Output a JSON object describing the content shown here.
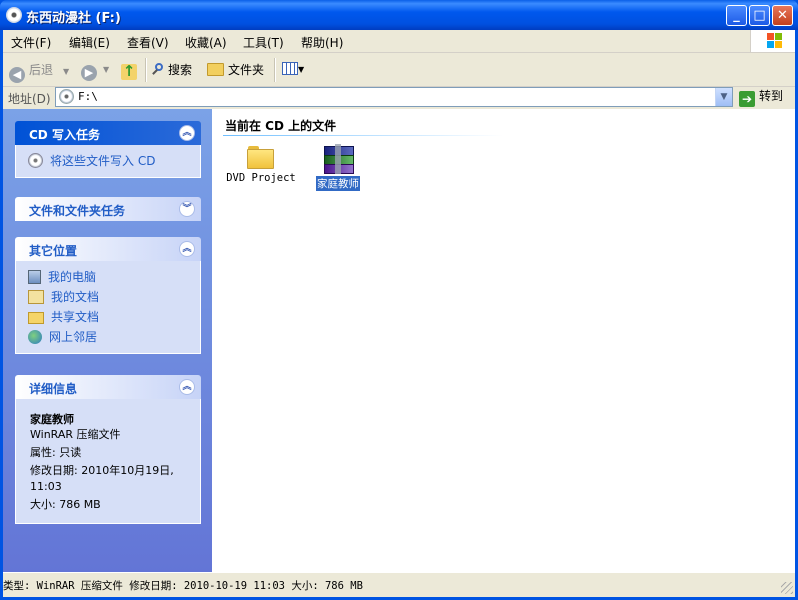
{
  "window": {
    "title": "东西动漫社 (F:)"
  },
  "title_buttons": {
    "minimize": "_",
    "maximize": "□",
    "close": "✕"
  },
  "menu": [
    "文件(F)",
    "编辑(E)",
    "查看(V)",
    "收藏(A)",
    "工具(T)",
    "帮助(H)"
  ],
  "toolbar": {
    "back": "后退",
    "search": "搜索",
    "folders": "文件夹"
  },
  "address": {
    "label": "地址(D)",
    "value": "F:\\",
    "go": "转到"
  },
  "panels": {
    "cd_tasks": {
      "title": "CD 写入任务",
      "items": [
        "将这些文件写入 CD"
      ]
    },
    "file_tasks": {
      "title": "文件和文件夹任务"
    },
    "other_places": {
      "title": "其它位置",
      "items": [
        "我的电脑",
        "我的文档",
        "共享文档",
        "网上邻居"
      ]
    },
    "details": {
      "title": "详细信息",
      "name": "家庭教师",
      "type": "WinRAR 压缩文件",
      "attributes": "属性: 只读",
      "modified": "修改日期: 2010年10月19日, 11:03",
      "size": "大小: 786 MB"
    }
  },
  "content": {
    "section_title": "当前在 CD 上的文件",
    "files": [
      {
        "name": "DVD Project",
        "icon": "folder-icon",
        "selected": false
      },
      {
        "name": "家庭教师",
        "icon": "winrar-archive-icon",
        "selected": true
      }
    ]
  },
  "status": {
    "text": "类型: WinRAR 压缩文件 修改日期: 2010-10-19 11:03 大小: 786 MB"
  },
  "colors": {
    "title_blue": "#0054e3",
    "task_link": "#215dc6",
    "selection": "#316ac5",
    "sidebar_top": "#7ba2e7",
    "sidebar_bottom": "#6375d6"
  }
}
